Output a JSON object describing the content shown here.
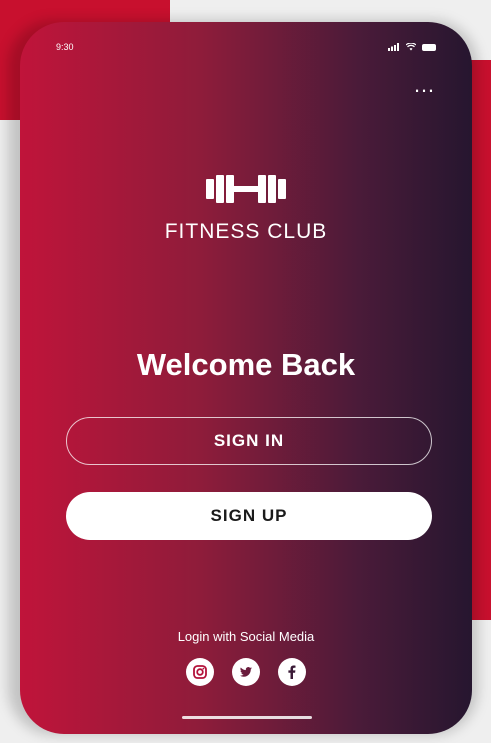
{
  "status_bar": {
    "time": "9:30"
  },
  "menu": {
    "more_label": "…",
    "more_icon": "more-horizontal-icon"
  },
  "brand": {
    "logo_icon": "dumbbell-icon",
    "name": "FITNESS CLUB"
  },
  "welcome": {
    "title": "Welcome Back"
  },
  "actions": {
    "sign_in": "SIGN IN",
    "sign_up": "SIGN UP"
  },
  "social": {
    "label": "Login with Social Media",
    "icons": [
      "instagram-icon",
      "twitter-icon",
      "facebook-icon"
    ]
  },
  "colors": {
    "gradient_start": "#c0143a",
    "gradient_end": "#26162f",
    "accent_red": "#c8102e",
    "button_white": "#ffffff"
  }
}
